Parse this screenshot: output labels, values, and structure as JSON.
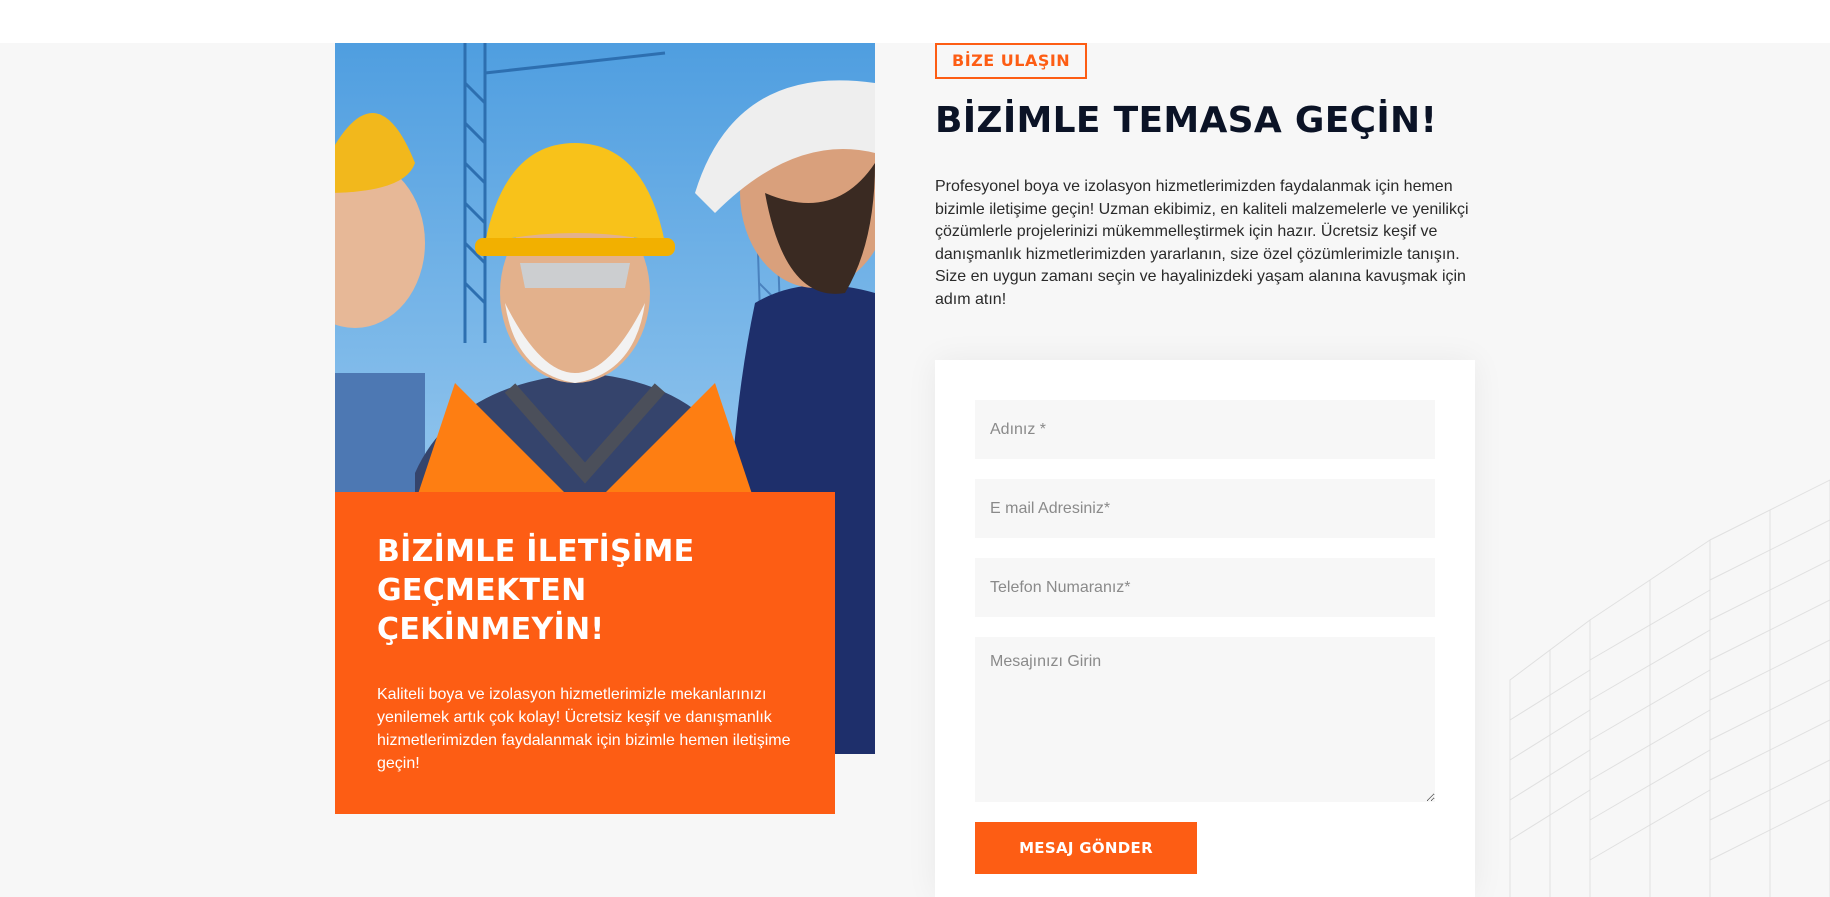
{
  "contact_tag": "BİZE ULAŞIN",
  "heading": "BİZİMLE TEMASA GEÇİN!",
  "intro_text": "Profesyonel boya ve izolasyon hizmetlerimizden faydalanmak için hemen bizimle iletişime geçin! Uzman ekibimiz, en kaliteli malzemelerle ve yenilikçi çözümlerle projelerinizi mükemmelleştirmek için hazır. Ücretsiz keşif ve danışmanlık hizmetlerimizden yararlanın, size özel çözümlerimizle tanışın. Size en uygun zamanı seçin ve hayalinizdeki yaşam alanına kavuşmak için adım atın!",
  "promo": {
    "title": "BİZİMLE İLETİŞİME\nGEÇMEKTEN\nÇEKİNMEYİN!",
    "text": "Kaliteli boya ve izolasyon hizmetlerimizle mekanlarınızı yenilemek artık çok kolay! Ücretsiz keşif ve danışmanlık hizmetlerimizden faydalanmak için bizimle hemen iletişime geçin!"
  },
  "form": {
    "name_placeholder": "Adınız *",
    "email_placeholder": "E mail Adresiniz*",
    "phone_placeholder": "Telefon Numaranız*",
    "message_placeholder": "Mesajınızı Girin",
    "submit_label": "MESAJ GÖNDER"
  },
  "colors": {
    "accent": "#fd5d14",
    "heading": "#0b1326",
    "background": "#f7f7f7"
  }
}
